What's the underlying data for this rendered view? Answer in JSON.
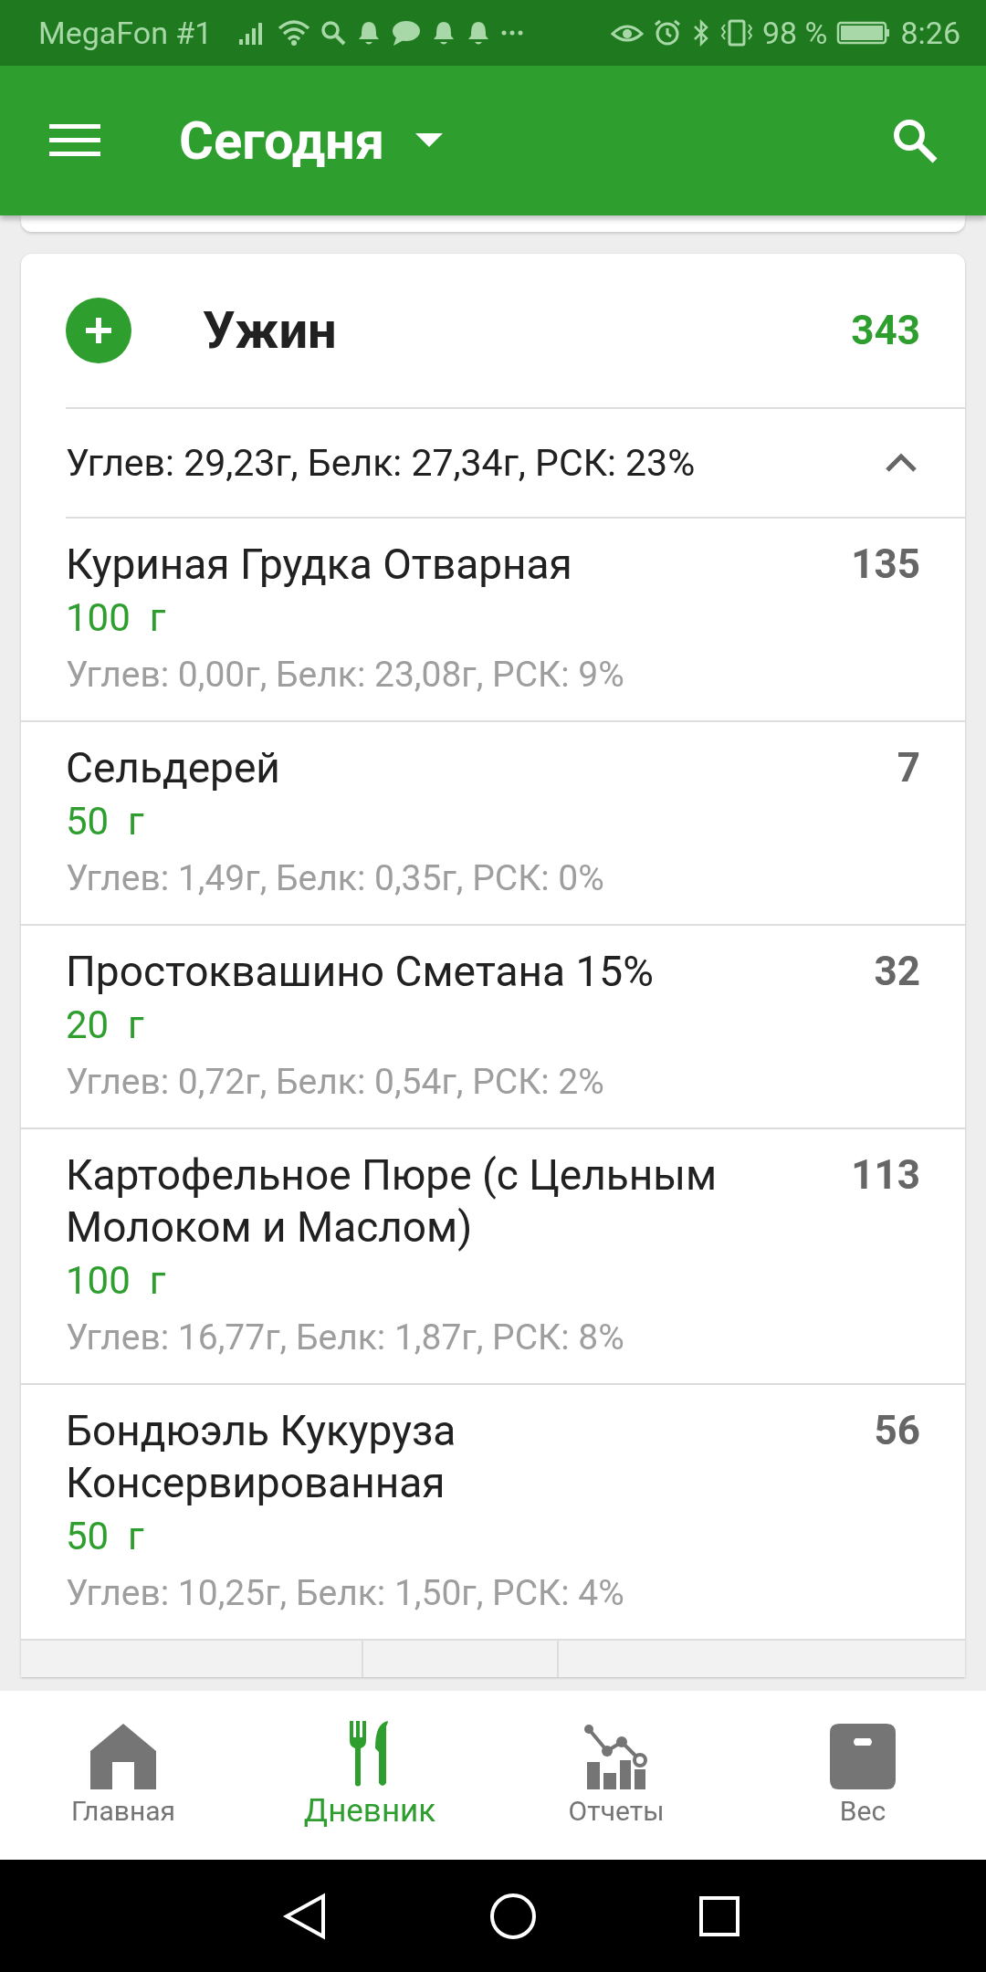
{
  "status_bar": {
    "carrier": "MegaFon #1",
    "battery": "98 %",
    "time": "8:26"
  },
  "app_bar": {
    "title": "Сегодня"
  },
  "meal": {
    "title": "Ужин",
    "calories": "343",
    "summary": "Углев: 29,23г, Белк: 27,34г, РСК: 23%",
    "expanded": true,
    "items": [
      {
        "name": "Куриная Грудка Отварная",
        "amount": "100  г",
        "macros": "Углев: 0,00г, Белк: 23,08г, РСК: 9%",
        "calories": "135"
      },
      {
        "name": "Сельдерей",
        "amount": "50  г",
        "macros": "Углев: 1,49г, Белк: 0,35г, РСК: 0%",
        "calories": "7"
      },
      {
        "name": "Простоквашино Сметана 15%",
        "amount": "20  г",
        "macros": "Углев: 0,72г, Белк: 0,54г, РСК: 2%",
        "calories": "32"
      },
      {
        "name": "Картофельное Пюре (с Цельным Молоком и Маслом)",
        "amount": "100  г",
        "macros": "Углев: 16,77г, Белк: 1,87г, РСК: 8%",
        "calories": "113"
      },
      {
        "name": "Бондюэль Кукуруза Консервированная",
        "amount": "50  г",
        "macros": "Углев: 10,25г, Белк: 1,50г, РСК: 4%",
        "calories": "56"
      }
    ]
  },
  "bottom_nav": [
    {
      "kind": "home",
      "label": "Главная",
      "selected": false
    },
    {
      "kind": "diary",
      "label": "Дневник",
      "selected": true
    },
    {
      "kind": "reports",
      "label": "Отчеты",
      "selected": false
    },
    {
      "kind": "weight",
      "label": "Вес",
      "selected": false
    }
  ]
}
